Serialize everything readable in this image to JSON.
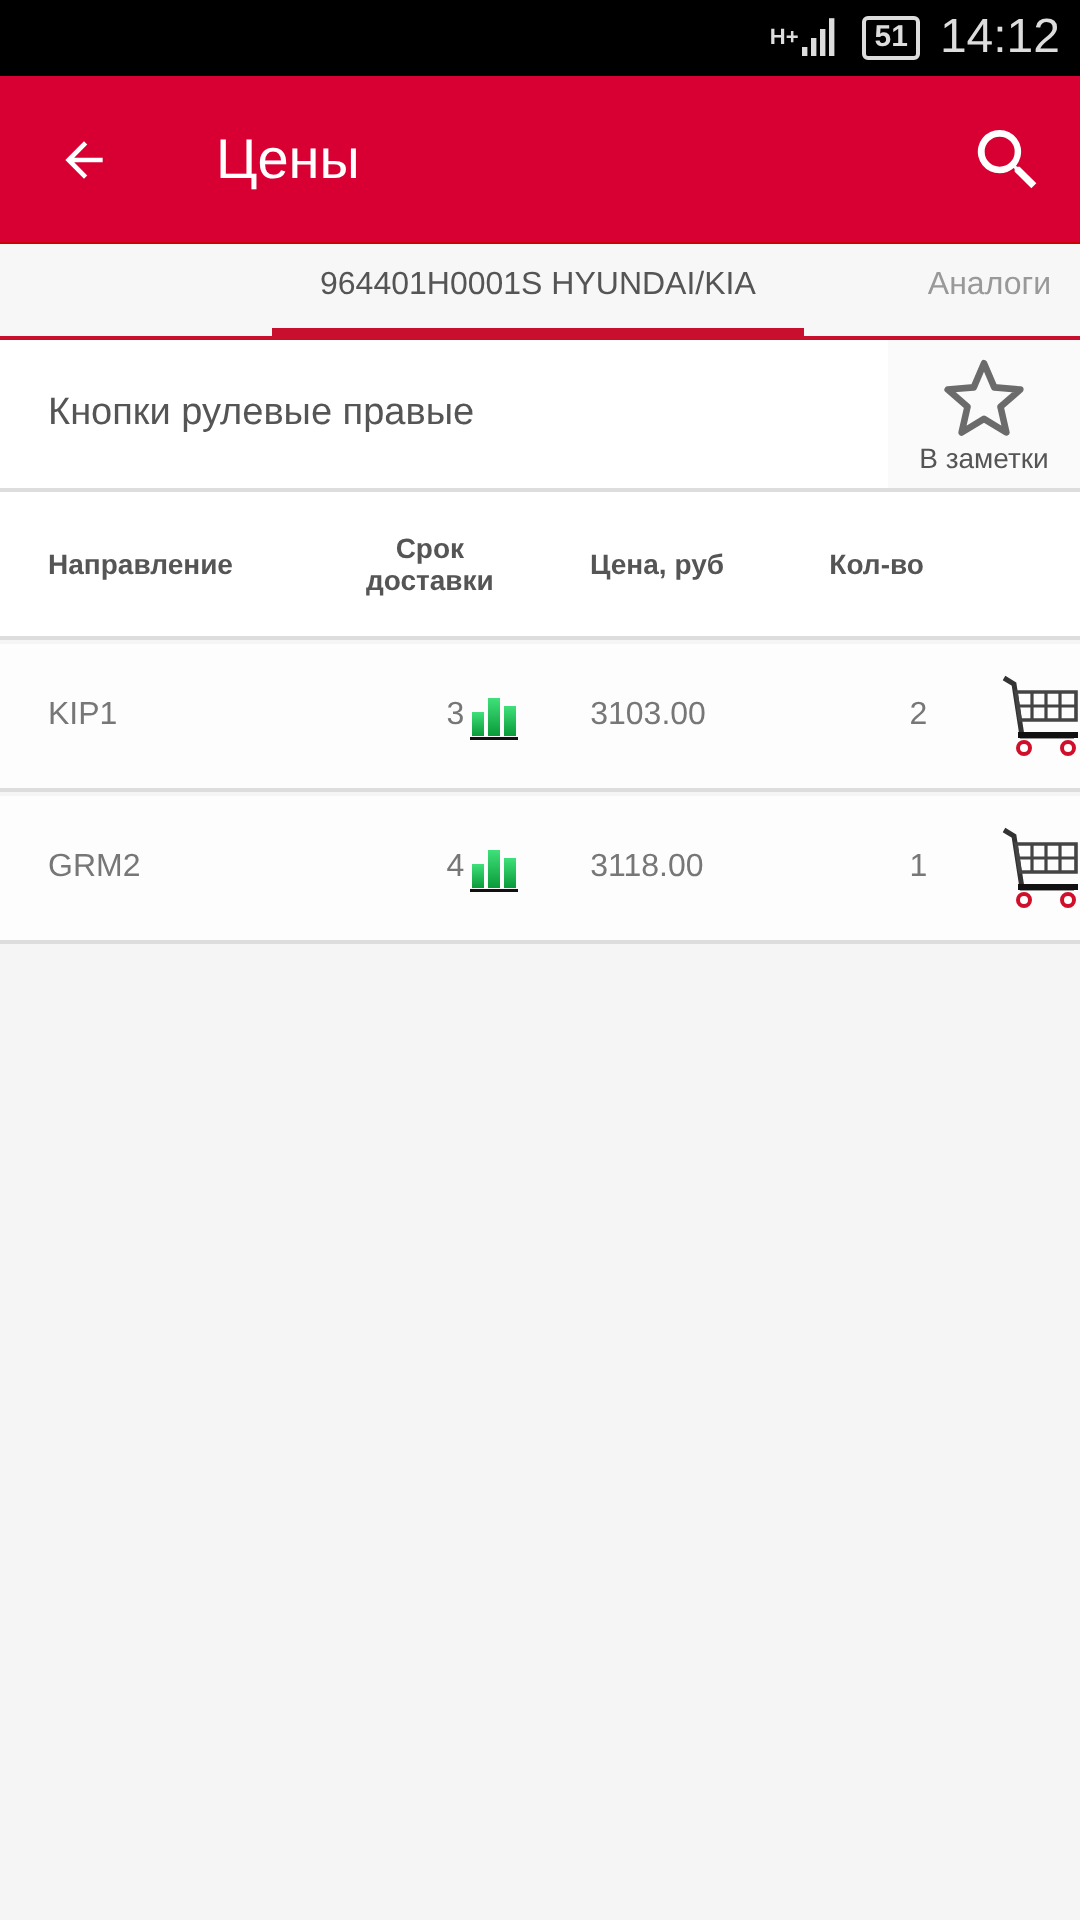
{
  "status_bar": {
    "network": "H+",
    "battery": "51",
    "time": "14:12"
  },
  "app_bar": {
    "title": "Цены"
  },
  "tabs": [
    {
      "label": "964401H0001S HYUNDAI/KIA",
      "selected": true
    },
    {
      "label": "Аналоги",
      "selected": false
    }
  ],
  "product": {
    "name": "Кнопки рулевые правые",
    "notes_label": "В заметки"
  },
  "table": {
    "columns": [
      "Направление",
      "Срок доставки",
      "Цена, руб",
      "Кол-во"
    ],
    "rows": [
      {
        "direction": "KIP1",
        "delivery": "3",
        "price": "3103.00",
        "quantity": "2"
      },
      {
        "direction": "GRM2",
        "delivery": "4",
        "price": "3118.00",
        "quantity": "1"
      }
    ]
  }
}
